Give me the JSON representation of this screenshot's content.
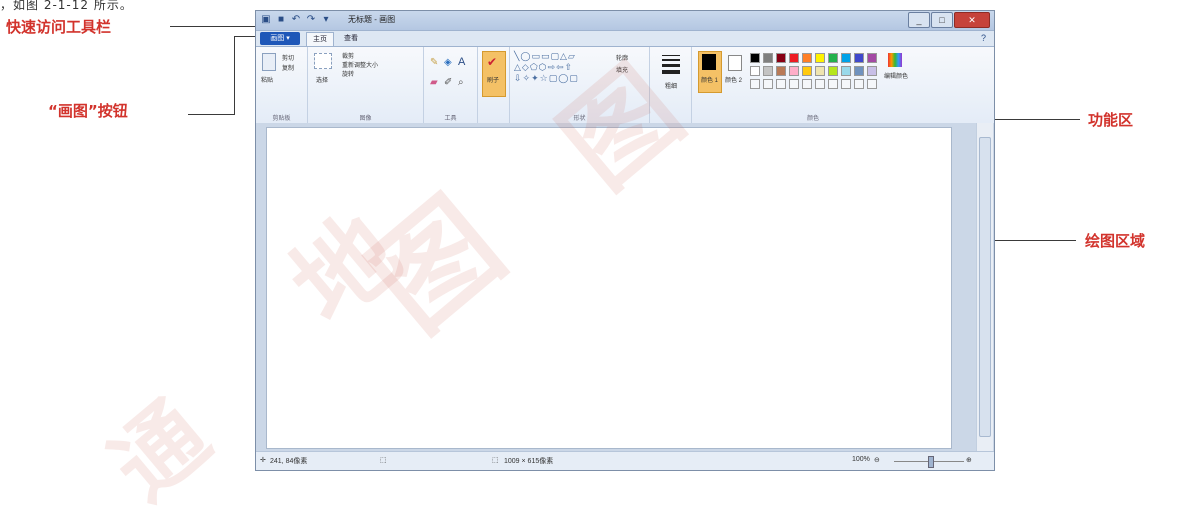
{
  "caption_fragment": "，如图 2-1-12 所示。",
  "annotations": {
    "quick_access": "快速访问工具栏",
    "paint_button": "“画图”按钮",
    "ribbon": "功能区",
    "drawing_area": "绘图区域"
  },
  "window": {
    "title": "无标题 - 画图",
    "paint_button_label": "画图 ▾",
    "tabs": [
      "主页",
      "查看"
    ]
  },
  "ribbon": {
    "clipboard": {
      "paste": "粘贴",
      "cut": "剪切",
      "copy": "复制",
      "label": "剪贴板"
    },
    "image": {
      "select": "选择",
      "crop": "裁剪",
      "resize": "重新调整大小",
      "rotate": "旋转",
      "label": "图像"
    },
    "tools": {
      "label": "工具"
    },
    "brushes": {
      "label": "刷子"
    },
    "shapes": {
      "outline": "轮廓",
      "fill": "填充",
      "label": "形状"
    },
    "size": {
      "label": "粗细"
    },
    "colors": {
      "color1": "颜色 1",
      "color2": "颜色 2",
      "edit": "编辑颜色",
      "label": "颜色"
    },
    "palette": [
      "#000000",
      "#7f7f7f",
      "#880015",
      "#ed1c24",
      "#ff7f27",
      "#fff200",
      "#22b14c",
      "#00a2e8",
      "#3f48cc",
      "#a349a4",
      "#ffffff",
      "#c3c3c3",
      "#b97a57",
      "#ffaec9",
      "#ffc90e",
      "#efe4b0",
      "#b5e61d",
      "#99d9ea",
      "#7092be",
      "#c8bfe7"
    ]
  },
  "status": {
    "cursor": "241, 84像素",
    "size": "1009 × 615像素",
    "zoom": "100%"
  },
  "watermarks": [
    "图",
    "地",
    "图",
    "通"
  ]
}
